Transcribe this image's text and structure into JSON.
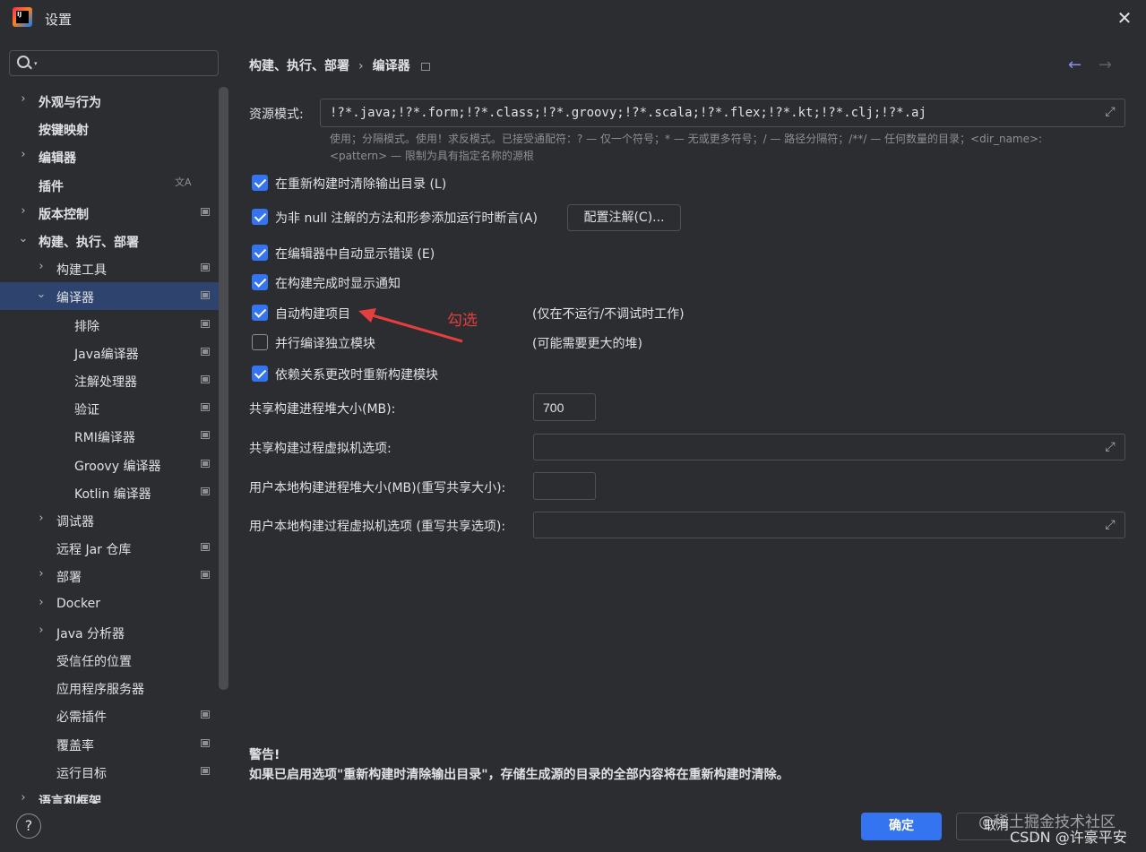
{
  "window": {
    "title": "设置",
    "close_glyph": "✕"
  },
  "search": {
    "value": "",
    "placeholder": "",
    "caret": "▾"
  },
  "sidebar": {
    "items": [
      {
        "label": "外观与行为",
        "bold": true,
        "expander": "›",
        "has_project_icon": false
      },
      {
        "label": "按键映射",
        "bold": true,
        "expander": "",
        "has_project_icon": false
      },
      {
        "label": "编辑器",
        "bold": true,
        "expander": "›",
        "has_project_icon": false
      },
      {
        "label": "插件",
        "bold": true,
        "expander": "",
        "has_project_icon": false,
        "badge_icon": "translate-icon"
      },
      {
        "label": "版本控制",
        "bold": true,
        "expander": "›",
        "has_project_icon": true
      },
      {
        "label": "构建、执行、部署",
        "bold": true,
        "expander": "⌄",
        "has_project_icon": false
      },
      {
        "label": "构建工具",
        "bold": false,
        "expander": "›",
        "has_project_icon": true
      },
      {
        "label": "编译器",
        "bold": false,
        "expander": "⌄",
        "has_project_icon": true,
        "selected": true
      },
      {
        "label": "排除",
        "bold": false,
        "expander": "",
        "has_project_icon": true
      },
      {
        "label": "Java编译器",
        "bold": false,
        "expander": "",
        "has_project_icon": true
      },
      {
        "label": "注解处理器",
        "bold": false,
        "expander": "",
        "has_project_icon": true
      },
      {
        "label": "验证",
        "bold": false,
        "expander": "",
        "has_project_icon": true
      },
      {
        "label": "RMI编译器",
        "bold": false,
        "expander": "",
        "has_project_icon": true
      },
      {
        "label": "Groovy 编译器",
        "bold": false,
        "expander": "",
        "has_project_icon": true
      },
      {
        "label": "Kotlin 编译器",
        "bold": false,
        "expander": "",
        "has_project_icon": true
      },
      {
        "label": "调试器",
        "bold": false,
        "expander": "›",
        "has_project_icon": false
      },
      {
        "label": "远程 Jar 仓库",
        "bold": false,
        "expander": "",
        "has_project_icon": true
      },
      {
        "label": "部署",
        "bold": false,
        "expander": "›",
        "has_project_icon": true
      },
      {
        "label": "Docker",
        "bold": false,
        "expander": "›",
        "has_project_icon": false
      },
      {
        "label": "Java 分析器",
        "bold": false,
        "expander": "›",
        "has_project_icon": false
      },
      {
        "label": "受信任的位置",
        "bold": false,
        "expander": "",
        "has_project_icon": false
      },
      {
        "label": "应用程序服务器",
        "bold": false,
        "expander": "",
        "has_project_icon": false
      },
      {
        "label": "必需插件",
        "bold": false,
        "expander": "",
        "has_project_icon": true
      },
      {
        "label": "覆盖率",
        "bold": false,
        "expander": "",
        "has_project_icon": true
      },
      {
        "label": "运行目标",
        "bold": false,
        "expander": "",
        "has_project_icon": true
      },
      {
        "label": "语言和框架",
        "bold": true,
        "expander": "›",
        "has_project_icon": false
      }
    ]
  },
  "header": {
    "crumb_parent": "构建、执行、部署",
    "crumb_sep": "›",
    "crumb_current": "编译器",
    "back_glyph": "←",
    "forward_glyph": "→"
  },
  "resources": {
    "label": "资源模式:",
    "value": "!?*.java;!?*.form;!?*.class;!?*.groovy;!?*.scala;!?*.flex;!?*.kt;!?*.clj;!?*.aj",
    "hint_line1": "使用；分隔模式。使用！求反模式。已接受通配符：? — 仅一个符号；* — 无或更多符号；/ — 路径分隔符；/**/ — 任何数量的目录；<dir_name>:",
    "hint_line2": "<pattern> — 限制为具有指定名称的源根"
  },
  "options": {
    "clear_output": {
      "label": "在重新构建时清除输出目录 (L)",
      "checked": true
    },
    "not_null_assert": {
      "label": "为非 null 注解的方法和形参添加运行时断言(A)",
      "checked": true
    },
    "configure_annotations_button": "配置注解(C)...",
    "show_errors": {
      "label": "在编辑器中自动显示错误 (E)",
      "checked": true
    },
    "notify_done": {
      "label": "在构建完成时显示通知",
      "checked": true
    },
    "auto_build": {
      "label": "自动构建项目",
      "checked": true,
      "note": "(仅在不运行/不调试时工作)"
    },
    "parallel": {
      "label": "并行编译独立模块",
      "checked": false,
      "note": "(可能需要更大的堆)"
    },
    "rebuild_deps": {
      "label": "依赖关系更改时重新构建模块",
      "checked": true
    }
  },
  "annotation": {
    "text": "勾选",
    "color": "#e53e3e"
  },
  "heap": {
    "shared_heap_label": "共享构建进程堆大小(MB):",
    "shared_heap_value": "700",
    "shared_vm_label": "共享构建过程虚拟机选项:",
    "shared_vm_value": "",
    "user_heap_label": "用户本地构建进程堆大小(MB)(重写共享大小):",
    "user_heap_value": "",
    "user_vm_label": "用户本地构建过程虚拟机选项 (重写共享选项):",
    "user_vm_value": ""
  },
  "warning": {
    "title": "警告!",
    "text": "如果已启用选项\"重新构建时清除输出目录\"，存储生成源的目录的全部内容将在重新构建时清除。"
  },
  "footer": {
    "help": "?",
    "ok": "确定",
    "cancel": "取消",
    "watermark1": "@稀土掘金技术社区",
    "watermark2": "CSDN @许豪平安"
  },
  "colors": {
    "accent": "#3574f0",
    "background": "#2b2d30",
    "selection": "#2e436e",
    "annotation": "#e53e3e"
  }
}
